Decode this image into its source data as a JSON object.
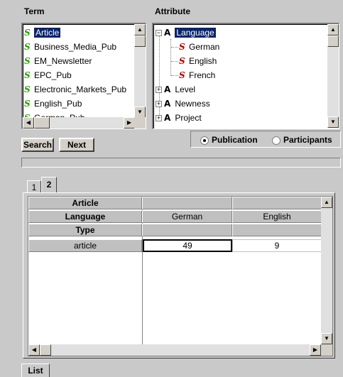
{
  "term": {
    "header": "Term",
    "items": [
      {
        "label": "Article",
        "selected": true
      },
      {
        "label": "Business_Media_Pub"
      },
      {
        "label": "EM_Newsletter"
      },
      {
        "label": "EPC_Pub"
      },
      {
        "label": "Electronic_Markets_Pub"
      },
      {
        "label": "English_Pub"
      },
      {
        "label": "German_Pub"
      }
    ]
  },
  "attribute": {
    "header": "Attribute",
    "root": {
      "label": "Language",
      "expander": "−"
    },
    "children": [
      "German",
      "English",
      "French"
    ],
    "siblings": [
      {
        "label": "Level",
        "expander": "+"
      },
      {
        "label": "Newness",
        "expander": "+"
      },
      {
        "label": "Project",
        "expander": "+"
      }
    ]
  },
  "buttons": {
    "search": "Search",
    "next": "Next",
    "list": "List"
  },
  "radios": {
    "publication": {
      "label": "Publication",
      "checked": true
    },
    "participants": {
      "label": "Participants",
      "checked": false
    }
  },
  "tabs": [
    "1",
    "2"
  ],
  "table": {
    "term": "Article",
    "attribute": "Language",
    "type_label": "Type",
    "columns": [
      "German",
      "English"
    ],
    "rows": [
      {
        "label": "article",
        "values": [
          "49",
          "9"
        ]
      }
    ]
  },
  "colors": {
    "selection": "#0a246a",
    "background": "#c9c9c9"
  }
}
